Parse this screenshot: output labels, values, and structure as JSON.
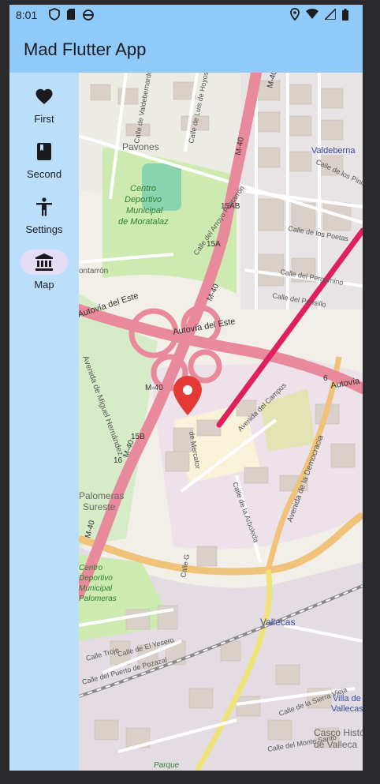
{
  "status_bar": {
    "time": "8:01",
    "left_icons": [
      "shield-icon",
      "sim-card-icon",
      "android-icon"
    ],
    "right_icons": [
      "location-icon",
      "wifi-icon",
      "signal-icon",
      "battery-icon"
    ]
  },
  "app_bar": {
    "title": "Mad Flutter App",
    "color": "#90caf9"
  },
  "nav_rail": {
    "color": "#bbdefb",
    "items": [
      {
        "label": "First",
        "icon": "heart-icon",
        "selected": false
      },
      {
        "label": "Second",
        "icon": "book-icon",
        "selected": false
      },
      {
        "label": "Settings",
        "icon": "accessibility-icon",
        "selected": false
      },
      {
        "label": "Map",
        "icon": "museum-icon",
        "selected": true
      }
    ]
  },
  "map": {
    "marker_icon": "map-pin-icon",
    "marker_color": "#e53935",
    "route_color": "#e0205e",
    "labels": {
      "pavones": "Pavones",
      "valdebernardo": "Valdeberna",
      "centro1": "Centro",
      "centro2": "Deportivo",
      "centro3": "Municipal",
      "centro4": "de Moratalaz",
      "fontarron_road": "Calle del Arroyo Fontarrón",
      "fontarron": "ontarrón",
      "poetas": "Calle de los Poetas",
      "pergamino": "Calle del Pergamino",
      "pensillo": "Calle del Pensillo",
      "pinilla": "Calle de los Pinilla",
      "valdebernardo_st": "Calle de Valdebernardo",
      "luis_hoyos": "Calle de Luis de Hoyos Sainz",
      "autovia_este_1": "Autovía del Este",
      "autovia_este_2": "Autovía del Este",
      "autovia_este_3": "Autovía",
      "miguel_hernandez": "Avenida de Miguel Hernández",
      "mercator": "de Mercator",
      "campus": "Avenida del Campus",
      "arboleda": "Calle de la Arboleda",
      "democracia": "Avenida de la Democracia",
      "palomeras1": "Palomeras",
      "palomeras2": "Sureste",
      "cdm1": "Centro",
      "cdm2": "Deportivo",
      "cdm3": "Municipal",
      "cdm4": "Palomeras",
      "yesero": "Calle de El Yesero",
      "troje": "Calle Troje",
      "pozazal": "Calle del Puerto de Pozazal",
      "vallecas": "Vallecas",
      "villa1": "Villa de",
      "villa2": "Vallecas",
      "casco1": "Casco Histó",
      "casco2": "de Valleca",
      "sierra_vieja": "Calle de la Sierra Vieja",
      "monte_santo": "Calle del Monte Santo",
      "parque": "Parque",
      "calle_g": "Calle G",
      "m40a": "M-40",
      "m40b": "M-40",
      "m40c": "M-40",
      "m40d": "M-40",
      "m40e": "M-40",
      "m40f": "M-40",
      "x15ab": "15AB",
      "x15a": "15A",
      "x15b": "15B",
      "x16": "16",
      "x6": "6"
    }
  }
}
